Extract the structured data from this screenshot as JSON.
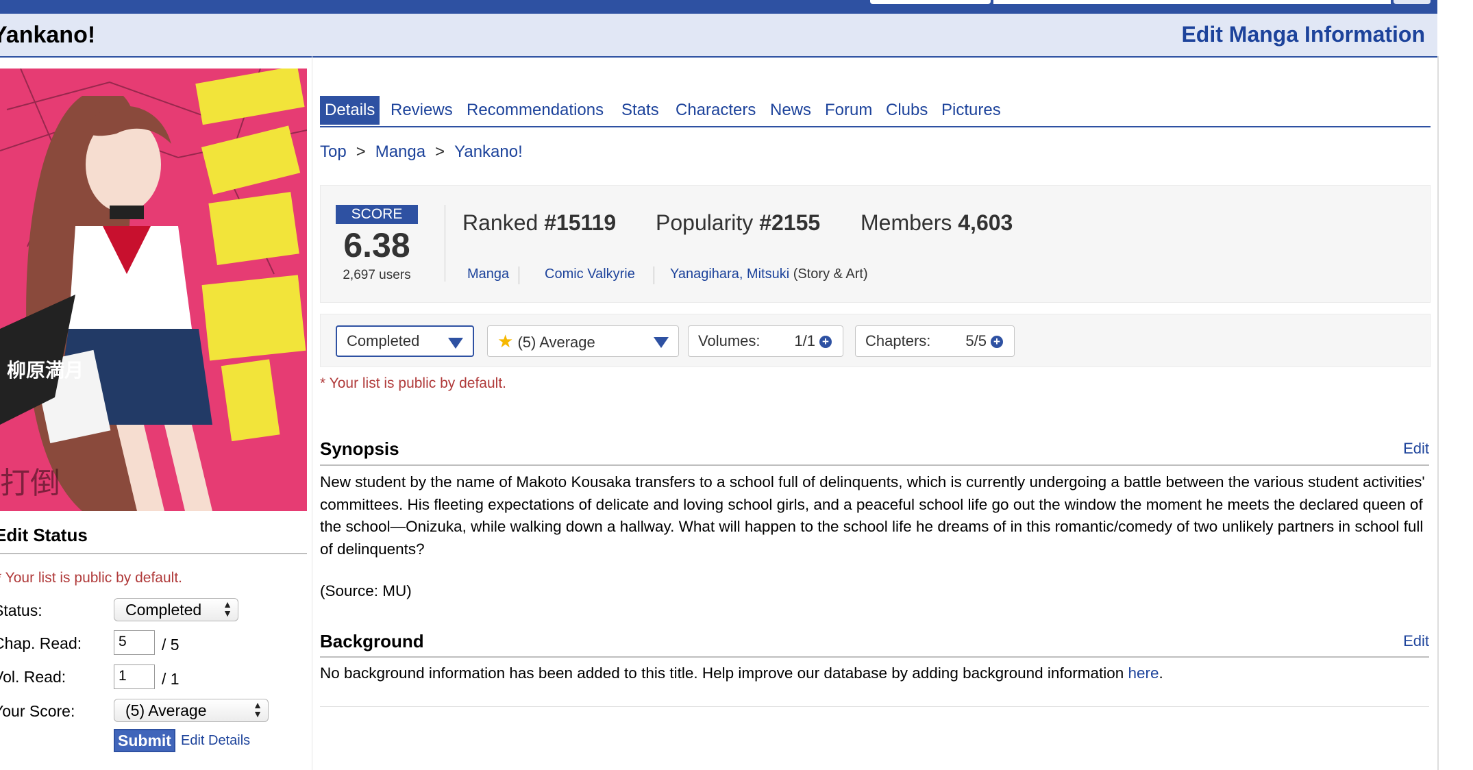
{
  "header": {
    "title": "Yankano!",
    "edit_label": "Edit Manga Information"
  },
  "tabs": [
    {
      "label": "Details"
    },
    {
      "label": "Reviews"
    },
    {
      "label": "Recommendations"
    },
    {
      "label": "Stats"
    },
    {
      "label": "Characters"
    },
    {
      "label": "News"
    },
    {
      "label": "Forum"
    },
    {
      "label": "Clubs"
    },
    {
      "label": "Pictures"
    }
  ],
  "breadcrumb": {
    "items": [
      "Top",
      "Manga",
      "Yankano!"
    ],
    "separator": ">"
  },
  "stats": {
    "score_label": "SCORE",
    "score": "6.38",
    "users": "2,697 users",
    "ranked_label": "Ranked",
    "ranked_value": "#15119",
    "popularity_label": "Popularity",
    "popularity_value": "#2155",
    "members_label": "Members",
    "members_value": "4,603",
    "type": "Manga",
    "serialization": "Comic Valkyrie",
    "author": "Yanagihara, Mitsuki",
    "author_role": "(Story & Art)"
  },
  "user_controls": {
    "status": "Completed",
    "score": "(5) Average",
    "volumes_label": "Volumes:",
    "volumes_value": "1/1",
    "chapters_label": "Chapters:",
    "chapters_value": "5/5",
    "public_note": "* Your list is public by default."
  },
  "synopsis": {
    "title": "Synopsis",
    "edit_label": "Edit",
    "text": "New student by the name of Makoto Kousaka transfers to a school full of delinquents, which is currently undergoing a battle between the various student activities' committees. His fleeting expectations of delicate and loving school girls, and a peaceful school life go out the window the moment he meets the declared queen of the school—Onizuka, while walking down a hallway. What will happen to the school life he dreams of in this romantic/comedy of two unlikely partners in school full of delinquents?",
    "source": "(Source: MU)"
  },
  "background": {
    "title": "Background",
    "edit_label": "Edit",
    "text": "No background information has been added to this title. Help improve our database by adding background information ",
    "link_text": "here",
    "period": "."
  },
  "edit_status": {
    "title": "Edit Status",
    "public_note": "* Your list is public by default.",
    "status_label": "Status:",
    "status_value": "Completed",
    "chap_label": "Chap. Read:",
    "chap_value": "5",
    "chap_total": "/ 5",
    "vol_label": "Vol. Read:",
    "vol_value": "1",
    "vol_total": "/ 1",
    "score_label": "Your Score:",
    "score_value": "(5) Average",
    "submit_label": "Submit",
    "edit_details_label": "Edit Details"
  },
  "colors": {
    "brand": "#2e51a2",
    "link": "#1d439b",
    "header_bg": "#e1e7f5",
    "note": "#b03a3a"
  }
}
